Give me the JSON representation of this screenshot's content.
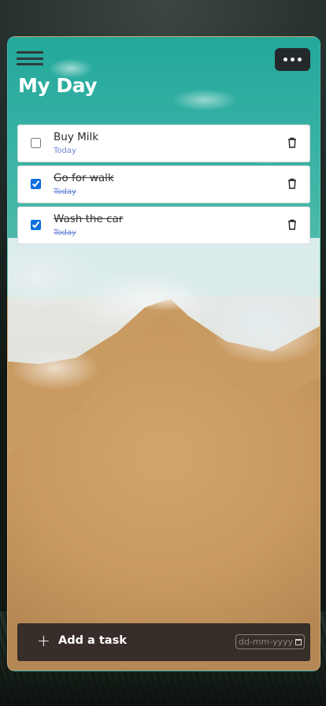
{
  "header": {
    "title": "My Day",
    "menu_icon": "hamburger-icon",
    "more_icon": "more-horizontal-icon"
  },
  "tasks": [
    {
      "name": "Buy Milk",
      "date": "Today",
      "done": false
    },
    {
      "name": "Go for walk",
      "date": "Today",
      "done": true
    },
    {
      "name": "Wash the car",
      "date": "Today",
      "done": true
    }
  ],
  "composer": {
    "add_label": "Add a task",
    "plus_icon": "+",
    "date_placeholder": "dd-mm-yyyy"
  },
  "colors": {
    "accent": "#0a6ee0",
    "date_text": "#6f86d6",
    "bar_bg": "#372e2a"
  }
}
